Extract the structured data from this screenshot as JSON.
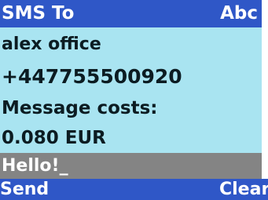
{
  "header": {
    "title": "SMS To",
    "input_mode": "Abc"
  },
  "recipient": {
    "name": "alex office",
    "number": "+447755500920"
  },
  "cost": {
    "label": "Message costs:",
    "value": "0.080 EUR"
  },
  "message": {
    "text": "Hello!_"
  },
  "softkeys": {
    "left": "Send",
    "right": "Clear"
  },
  "colors": {
    "bar": "#2f57c7",
    "content_bg": "#a9e4f1",
    "input_bg": "#848484",
    "text_dark": "#0c1c22",
    "text_light": "#ffffff"
  }
}
